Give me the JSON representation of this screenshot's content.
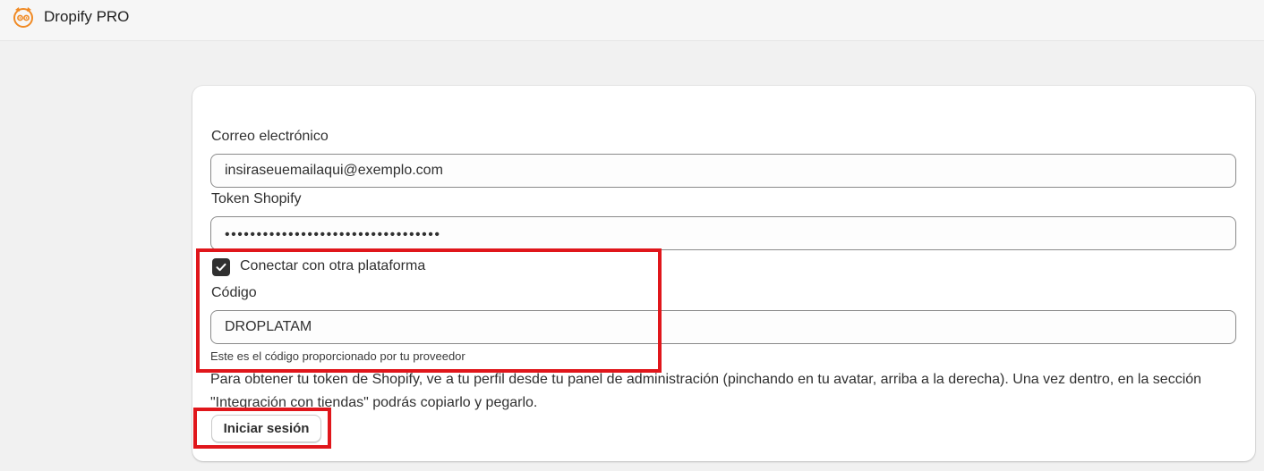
{
  "app": {
    "title": "Dropify PRO",
    "logo_icon": "dropify-logo-icon",
    "accent_color": "#f08a24"
  },
  "form": {
    "email": {
      "label": "Correo electrónico",
      "value": "insiraseuemailaqui@exemplo.com"
    },
    "token": {
      "label": "Token Shopify",
      "value": "••••••••••••••••••••••••••••••••••"
    },
    "connect_other": {
      "label": "Conectar con otra plataforma",
      "checked": true
    },
    "code": {
      "label": "Código",
      "value": "DROPLATAM",
      "help": "Este es el código proporcionado por tu proveedor"
    },
    "info_text": "Para obtener tu token de Shopify, ve a tu perfil desde tu panel de administración (pinchando en tu avatar, arriba a la derecha). Una vez dentro, en la sección \"Integración con tiendas\" podrás copiarlo y pegarlo.",
    "login_button": "Iniciar sesión"
  },
  "annotation_color": "#e0161b"
}
